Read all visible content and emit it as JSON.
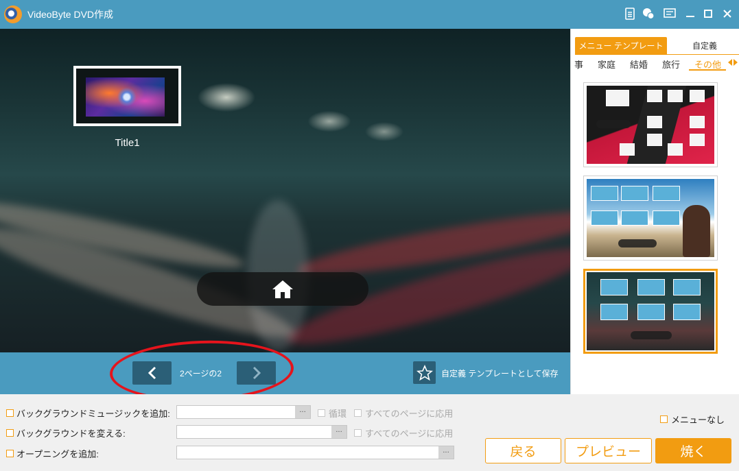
{
  "app": {
    "title": "VideoByte DVD作成"
  },
  "titlebar_icons": [
    "document-icon",
    "feedback-icon",
    "menu-list-icon",
    "minimize-icon",
    "maximize-icon",
    "close-icon"
  ],
  "preview": {
    "title_item_label": "Title1"
  },
  "page_nav": {
    "page_indicator": "2ページの2",
    "save_template_label": "自定義 テンプレートとして保存"
  },
  "right_panel": {
    "tabs": [
      {
        "label": "メニュー テンプレート",
        "active": true
      },
      {
        "label": "自定義",
        "active": false
      }
    ],
    "categories": [
      {
        "label": "事",
        "active": false
      },
      {
        "label": "家庭",
        "active": false
      },
      {
        "label": "結婚",
        "active": false
      },
      {
        "label": "旅行",
        "active": false
      },
      {
        "label": "その他",
        "active": true
      }
    ],
    "templates": [
      {
        "name": "template-red-black",
        "selected": false
      },
      {
        "name": "template-sky-girl",
        "selected": false
      },
      {
        "name": "template-night-road",
        "selected": true
      }
    ]
  },
  "options": {
    "bg_music": {
      "label": "バックグラウンドミュージックを追加:",
      "value": "",
      "loop_label": "循環",
      "apply_all_label": "すべてのページに応用"
    },
    "bg_change": {
      "label": "バックグラウンドを変える:",
      "value": "",
      "apply_all_label": "すべてのページに応用"
    },
    "opening": {
      "label": "オープニングを追加:",
      "value": ""
    },
    "browse_label": "···",
    "no_menu_label": "メニューなし"
  },
  "buttons": {
    "back": "戻る",
    "preview": "プレビュー",
    "burn": "焼く"
  },
  "colors": {
    "titlebar": "#4a9bbf",
    "accent": "#f29c11",
    "nav_button": "#2b5f77",
    "annotation": "#e5141c"
  }
}
